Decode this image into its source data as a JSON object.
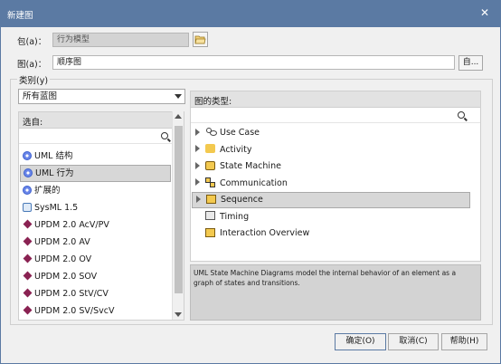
{
  "window": {
    "title": "新建图",
    "close_glyph": "✕"
  },
  "form": {
    "package_label": "包(a)：",
    "package_value": "行为模型",
    "diagram_label": "图(a)：",
    "diagram_value": "顺序图",
    "browse_label": "自...",
    "category_label": "类别(y)",
    "category_selected": "所有蓝图"
  },
  "left_panel": {
    "header": "选自:",
    "items": [
      {
        "label": "UML 结构",
        "icon": "uml-globe-icon"
      },
      {
        "label": "UML 行为",
        "icon": "uml-globe-icon",
        "selected": true
      },
      {
        "label": "扩展的",
        "icon": "uml-globe-icon"
      },
      {
        "label": "SysML 1.5",
        "icon": "sysml-icon"
      },
      {
        "label": "UPDM 2.0 AcV/PV",
        "icon": "updm-diamond-icon"
      },
      {
        "label": "UPDM 2.0 AV",
        "icon": "updm-diamond-icon"
      },
      {
        "label": "UPDM 2.0 OV",
        "icon": "updm-diamond-icon"
      },
      {
        "label": "UPDM 2.0 SOV",
        "icon": "updm-diamond-icon"
      },
      {
        "label": "UPDM 2.0 StV/CV",
        "icon": "updm-diamond-icon"
      },
      {
        "label": "UPDM 2.0 SV/SvcV",
        "icon": "updm-diamond-icon"
      }
    ]
  },
  "right_panel": {
    "header": "图的类型:",
    "items": [
      {
        "label": "Use Case",
        "icon": "use-case-icon",
        "expandable": true
      },
      {
        "label": "Activity",
        "icon": "activity-icon",
        "expandable": true
      },
      {
        "label": "State Machine",
        "icon": "state-machine-icon",
        "expandable": true
      },
      {
        "label": "Communication",
        "icon": "communication-icon",
        "expandable": true
      },
      {
        "label": "Sequence",
        "icon": "sequence-icon",
        "expandable": true,
        "selected": true
      },
      {
        "label": "Timing",
        "icon": "timing-icon",
        "expandable": false
      },
      {
        "label": "Interaction Overview",
        "icon": "interaction-overview-icon",
        "expandable": false
      }
    ],
    "description": "UML State Machine Diagrams model the internal behavior of an element as a graph of states and transitions."
  },
  "buttons": {
    "ok": "确定(O)",
    "cancel": "取消(C)",
    "help": "帮助(H)"
  },
  "colors": {
    "titlebar": "#5b7aa3",
    "selection": "#d7d7d7",
    "icon_yellow": "#f3c94f",
    "updm_diamond": "#8a2252",
    "uml_blue": "#3b5fcf"
  }
}
